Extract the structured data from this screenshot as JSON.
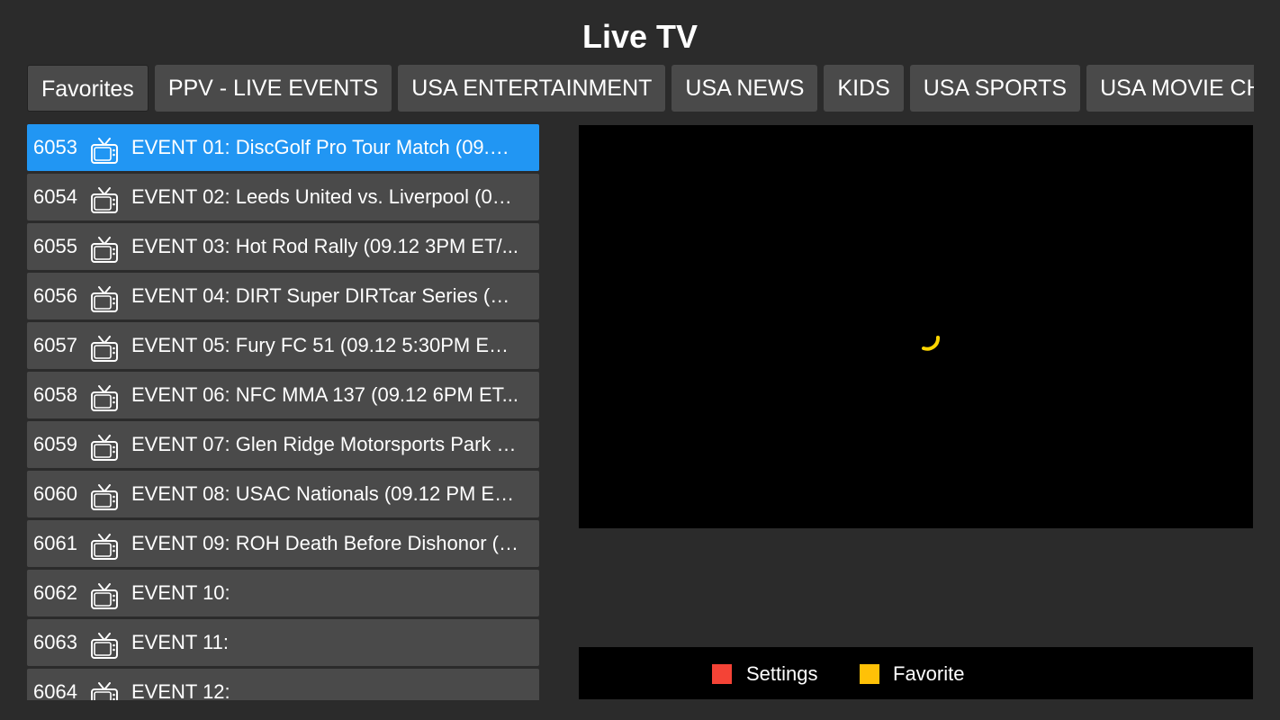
{
  "header": {
    "title": "Live TV"
  },
  "tabs": [
    {
      "label": "Favorites"
    },
    {
      "label": "PPV - LIVE EVENTS"
    },
    {
      "label": "USA ENTERTAINMENT"
    },
    {
      "label": "USA NEWS"
    },
    {
      "label": "KIDS"
    },
    {
      "label": "USA SPORTS"
    },
    {
      "label": "USA MOVIE CHANNELS"
    }
  ],
  "channels": [
    {
      "number": "6053",
      "name": "EVENT 01: DiscGolf Pro Tour Match (09.12 ...",
      "icon": "tv-icon",
      "selected": true
    },
    {
      "number": "6054",
      "name": "EVENT 02: Leeds United vs. Liverpool (09.12 ...",
      "icon": "tv-icon"
    },
    {
      "number": "6055",
      "name": "EVENT 03: Hot Rod Rally (09.12 3PM ET/...",
      "icon": "tv-icon"
    },
    {
      "number": "6056",
      "name": "EVENT 04: DIRT Super DIRTcar Series (09.12 ...",
      "icon": "tv-icon"
    },
    {
      "number": "6057",
      "name": "EVENT 05: Fury FC 51 (09.12 5:30PM ET/...",
      "icon": "tv-icon"
    },
    {
      "number": "6058",
      "name": "EVENT 06: NFC MMA 137 (09.12 6PM ET...",
      "icon": "tv-icon"
    },
    {
      "number": "6059",
      "name": "EVENT 07: Glen Ridge Motorsports Park (...",
      "icon": "tv-icon"
    },
    {
      "number": "6060",
      "name": "EVENT 08: USAC Nationals (09.12 PM ET...",
      "icon": "tv-icon"
    },
    {
      "number": "6061",
      "name": "EVENT 09: ROH Death Before Dishonor (09.12 ...",
      "icon": "tv-icon"
    },
    {
      "number": "6062",
      "name": "EVENT 10:",
      "icon": "tv-icon"
    },
    {
      "number": "6063",
      "name": "EVENT 11:",
      "icon": "tv-icon"
    },
    {
      "number": "6064",
      "name": "EVENT 12:",
      "icon": "tv-icon"
    }
  ],
  "player": {
    "loading_icon": "loading-spinner-icon",
    "spinner_color": "#ffd600"
  },
  "legend": [
    {
      "label": "Settings",
      "color": "#f44336"
    },
    {
      "label": "Favorite",
      "color": "#ffc107"
    }
  ],
  "colors": {
    "background": "#2b2b2b",
    "item": "#4a4a4a",
    "selected": "#2196f3",
    "player_bg": "#000000"
  }
}
